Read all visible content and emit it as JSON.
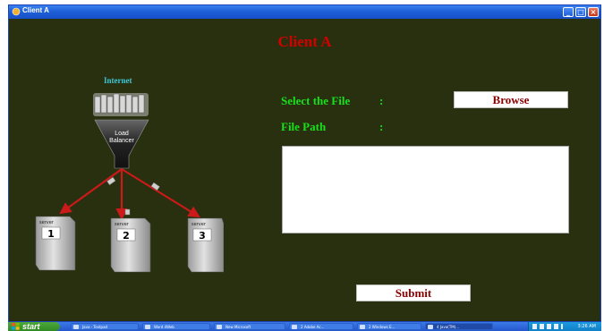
{
  "window": {
    "title": "Client A"
  },
  "header": {
    "title": "Client A"
  },
  "diagram": {
    "top_label": "Internet",
    "balancer_label_line1": "Load",
    "balancer_label_line2": "Balancer",
    "server_label": "server",
    "servers": [
      "1",
      "2",
      "3"
    ]
  },
  "form": {
    "select_file_label": "Select the File",
    "file_path_label": "File Path",
    "colon": ":",
    "browse_label": "Browse",
    "file_path_value": "",
    "submit_label": "Submit"
  },
  "taskbar": {
    "start_label": "start",
    "items": [
      "Java - Textpad",
      "Word 4Web",
      "New Microsoft",
      "2 Adobe Ac...",
      "2 Windows E...",
      "4 Java(TM)..."
    ],
    "clock": "3:26 AM"
  },
  "colors": {
    "background": "#28300f",
    "title": "#d40000",
    "labels": "#18e018",
    "button_text": "#8b0000",
    "internet_label": "#40c8d8",
    "arrows": "#cc1a1a"
  }
}
